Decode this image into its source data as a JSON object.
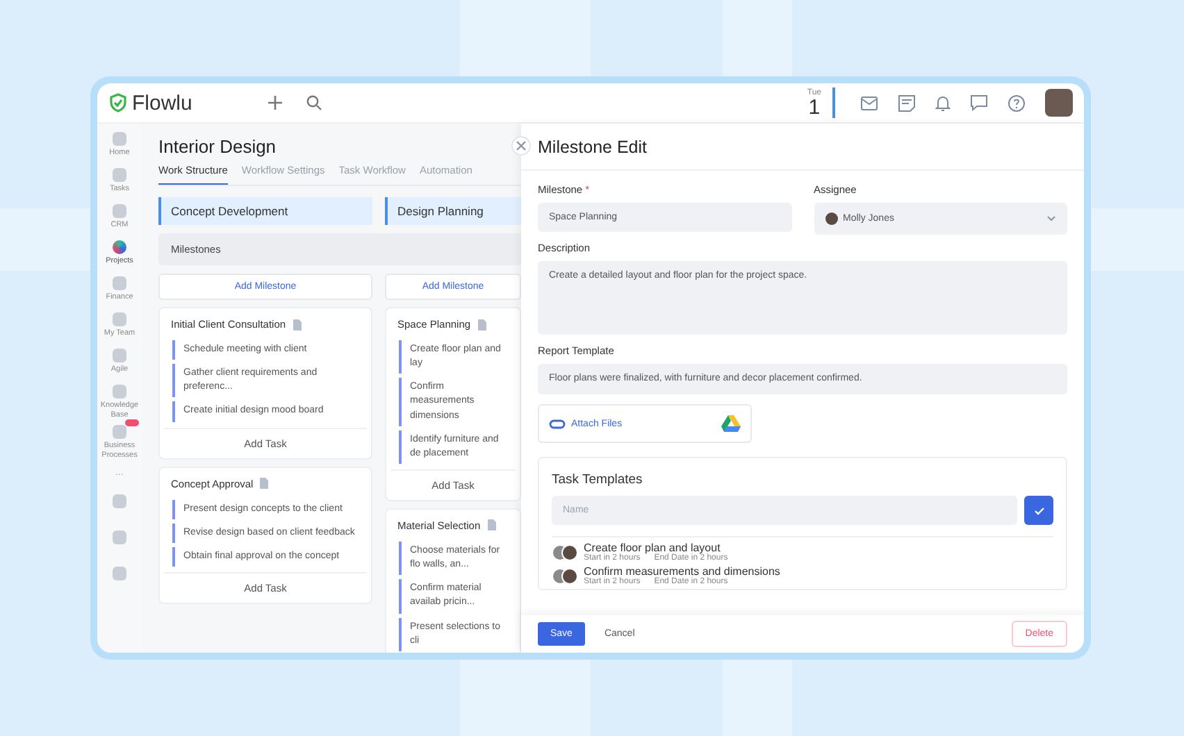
{
  "app": {
    "name": "Flowlu"
  },
  "date": {
    "weekday": "Tue",
    "day": "1"
  },
  "sidebar": {
    "items": [
      {
        "label": "Home",
        "selected": false,
        "badge": false
      },
      {
        "label": "Tasks",
        "selected": false,
        "badge": false
      },
      {
        "label": "CRM",
        "selected": false,
        "badge": false
      },
      {
        "label": "Projects",
        "selected": true,
        "badge": false
      },
      {
        "label": "Finance",
        "selected": false,
        "badge": false
      },
      {
        "label": "My Team",
        "selected": false,
        "badge": false
      },
      {
        "label": "Agile",
        "selected": false,
        "badge": false
      },
      {
        "label": "Knowledge Base",
        "selected": false,
        "badge": false
      },
      {
        "label": "Business Processes",
        "selected": false,
        "badge": true
      }
    ],
    "more": "..."
  },
  "project": {
    "title": "Interior Design",
    "tabs": [
      {
        "label": "Work Structure",
        "selected": true
      },
      {
        "label": "Workflow Settings",
        "selected": false
      },
      {
        "label": "Task Workflow",
        "selected": false
      },
      {
        "label": "Automation",
        "selected": false
      }
    ]
  },
  "board": {
    "milestones_label": "Milestones",
    "columns": [
      {
        "title": "Concept Development",
        "add_milestone": "Add Milestone",
        "milestones": [
          {
            "title": "Initial Client Consultation",
            "tasks": [
              "Schedule meeting with client",
              "Gather client requirements and preferenc...",
              "Create initial design mood board"
            ],
            "add_task": "Add Task"
          },
          {
            "title": "Concept Approval",
            "tasks": [
              "Present design concepts to the client",
              "Revise design based on client feedback",
              "Obtain final approval on the concept"
            ],
            "add_task": "Add Task"
          }
        ]
      },
      {
        "title": "Design Planning",
        "add_milestone": "Add Milestone",
        "milestones": [
          {
            "title": "Space Planning",
            "tasks": [
              "Create floor plan and lay",
              "Confirm measurements dimensions",
              "Identify furniture and de placement"
            ],
            "add_task": "Add Task"
          },
          {
            "title": "Material Selection",
            "tasks": [
              "Choose materials for flo walls, an...",
              "Confirm material availab pricin...",
              "Present selections to cli"
            ]
          }
        ]
      }
    ]
  },
  "panel": {
    "title": "Milestone Edit",
    "milestone": {
      "label": "Milestone",
      "required": true,
      "required_mark": "*",
      "value": "Space Planning"
    },
    "assignee": {
      "label": "Assignee",
      "value": "Molly Jones"
    },
    "description": {
      "label": "Description",
      "value": "Create a detailed layout and floor plan for the project space."
    },
    "report": {
      "label": "Report Template",
      "value": "Floor plans were finalized, with furniture and decor placement confirmed."
    },
    "attach": "Attach Files",
    "templates": {
      "title": "Task Templates",
      "placeholder": "Name",
      "items": [
        {
          "name": "Create floor plan and layout",
          "start": "Start in 2 hours",
          "end": "End Date in 2 hours"
        },
        {
          "name": "Confirm measurements and dimensions",
          "start": "Start in 2 hours",
          "end": "End Date in 2 hours"
        }
      ]
    },
    "buttons": {
      "save": "Save",
      "cancel": "Cancel",
      "delete": "Delete"
    }
  }
}
